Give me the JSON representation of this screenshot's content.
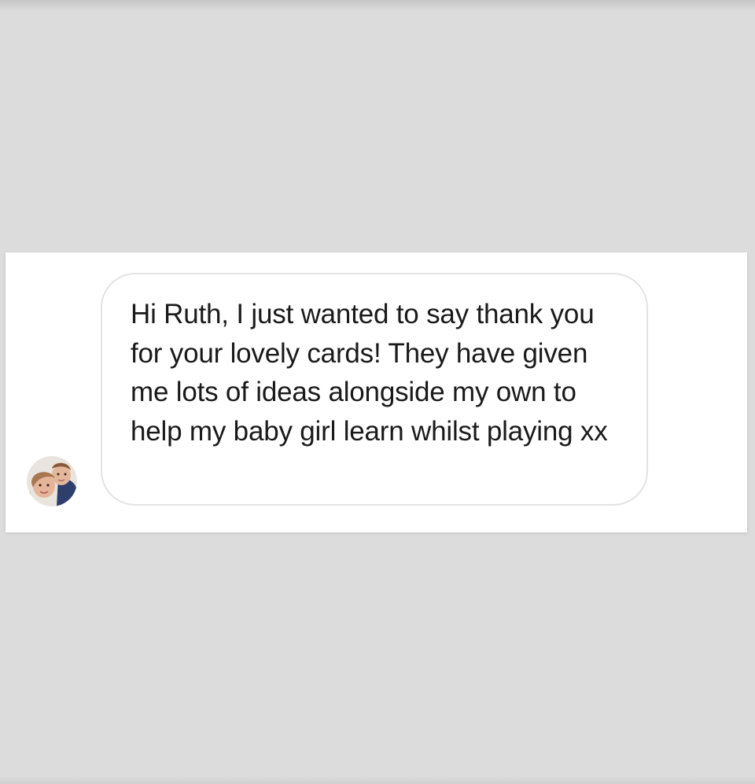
{
  "conversation": {
    "message": {
      "text": "Hi Ruth, I just wanted to say thank you for your lovely cards! They have given me lots of ideas alongside my own to help my baby girl learn whilst playing xx"
    },
    "sender": {
      "avatar_icon": "profile-photo-avatar"
    }
  },
  "colors": {
    "page_background": "#dcdcdc",
    "card_background": "#ffffff",
    "bubble_border": "#e3e3e3",
    "text": "#1a1a1a"
  }
}
